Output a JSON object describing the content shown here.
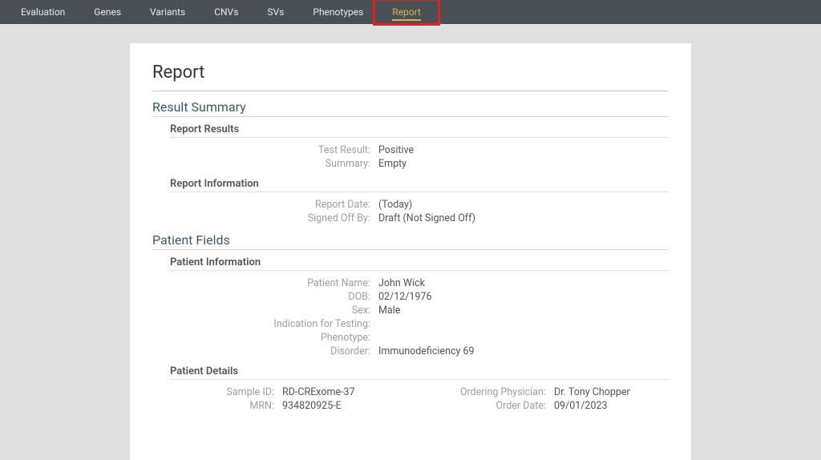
{
  "nav": {
    "items": [
      "Evaluation",
      "Genes",
      "Variants",
      "CNVs",
      "SVs",
      "Phenotypes",
      "Report"
    ],
    "activeIndex": 6
  },
  "pageTitle": "Report",
  "resultSummary": {
    "heading": "Result Summary",
    "reportResults": {
      "heading": "Report Results",
      "fields": {
        "testResult": {
          "label": "Test Result:",
          "value": "Positive"
        },
        "summary": {
          "label": "Summary:",
          "value": "Empty"
        }
      }
    },
    "reportInformation": {
      "heading": "Report Information",
      "fields": {
        "reportDate": {
          "label": "Report Date:",
          "value": "(Today)"
        },
        "signedOffBy": {
          "label": "Signed Off By:",
          "value": "Draft (Not Signed Off)"
        }
      }
    }
  },
  "patientFields": {
    "heading": "Patient Fields",
    "patientInformation": {
      "heading": "Patient Information",
      "fields": {
        "patientName": {
          "label": "Patient Name:",
          "value": "John Wick"
        },
        "dob": {
          "label": "DOB:",
          "value": "02/12/1976"
        },
        "sex": {
          "label": "Sex:",
          "value": "Male"
        },
        "indicationForTesting": {
          "label": "Indication for Testing:",
          "value": ""
        },
        "phenotype": {
          "label": "Phenotype:",
          "value": ""
        },
        "disorder": {
          "label": "Disorder:",
          "value": "Immunodeficiency 69"
        }
      }
    },
    "patientDetails": {
      "heading": "Patient Details",
      "left": {
        "sampleId": {
          "label": "Sample ID:",
          "value": "RD-CRExome-37"
        },
        "mrn": {
          "label": "MRN:",
          "value": "934820925-E"
        }
      },
      "right": {
        "orderingPhysician": {
          "label": "Ordering Physician:",
          "value": "Dr. Tony Chopper"
        },
        "orderDate": {
          "label": "Order Date:",
          "value": "09/01/2023"
        }
      }
    }
  }
}
